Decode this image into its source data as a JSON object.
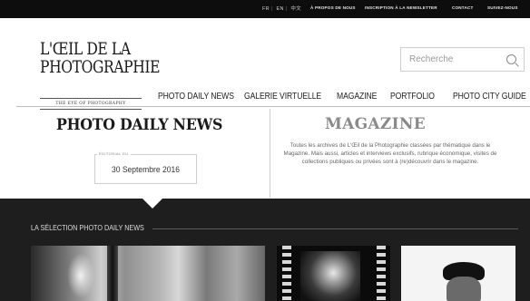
{
  "topbar": {
    "langs": [
      "FR",
      "EN",
      "中文"
    ],
    "links": [
      "À PROPOS DE NOUS",
      "INSCRIPTION À LA NEWSLETTER",
      "CONTACT",
      "SUIVEZ-NOUS"
    ]
  },
  "header": {
    "logo_line1": "L'ŒIL DE LA",
    "logo_line2": "PHOTOGRAPHIE",
    "logo_tagline": "THE EYE OF PHOTOGRAPHY",
    "search_placeholder": "Recherche"
  },
  "nav": [
    "PHOTO DAILY NEWS",
    "GALERIE VIRTUELLE",
    "MAGAZINE",
    "PORTFOLIO",
    "PHOTO CITY GUIDE"
  ],
  "daily": {
    "title": "PHOTO DAILY NEWS",
    "editorial_label": "ÉDITORIAL DU",
    "date": "30 Septembre 2016"
  },
  "magazine": {
    "title": "MAGAZINE",
    "description": "Toutes les archives de L'Œil de la Photographie classées par thématique dans le Magazine. Mais aussi, articles et interviews exclusifs, rubrique économique, visites de collections publiques ou privées sont à (re)découvrir dans le magazine."
  },
  "selection": {
    "title": "LA SÉLECTION PHOTO DAILY NEWS"
  },
  "icons": {
    "search": "search-icon"
  }
}
